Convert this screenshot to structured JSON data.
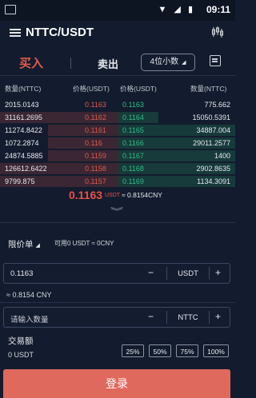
{
  "status_bar": {
    "time": "09:11",
    "icons": "▼ ◢ ▮"
  },
  "header": {
    "title": "NTTC/USDT"
  },
  "tabs": {
    "buy": "买入",
    "sell": "卖出",
    "decimals": "4位小数"
  },
  "orderbook": {
    "headers": [
      "数量(NTTC)",
      "价格(USDT)",
      "价格(USDT)",
      "数量(NTTC)"
    ],
    "rows": [
      {
        "sell_qty": "2015.0143",
        "sell_price": "0.1163",
        "buy_price": "0.1163",
        "buy_qty": "775.662"
      },
      {
        "sell_qty": "31161.2695",
        "sell_price": "0.1162",
        "buy_price": "0.1164",
        "buy_qty": "15050.5391"
      },
      {
        "sell_qty": "11274.8422",
        "sell_price": "0.1161",
        "buy_price": "0.1165",
        "buy_qty": "34887.004"
      },
      {
        "sell_qty": "1072.2874",
        "sell_price": "0.116",
        "buy_price": "0.1166",
        "buy_qty": "29011.2577"
      },
      {
        "sell_qty": "24874.5885",
        "sell_price": "0.1159",
        "buy_price": "0.1167",
        "buy_qty": "1400"
      },
      {
        "sell_qty": "126612.6422",
        "sell_price": "0.1158",
        "buy_price": "0.1168",
        "buy_qty": "2902.8635"
      },
      {
        "sell_qty": "9799.875",
        "sell_price": "0.1157",
        "buy_price": "0.1169",
        "buy_qty": "1134.3091"
      }
    ],
    "last_price": "0.1163",
    "last_unit": "USDT",
    "last_cny": "≈ 0.8154CNY"
  },
  "order": {
    "type": "限价单",
    "available": "可用0 USDT ≈ 0CNY",
    "price_value": "0.1163",
    "price_unit": "USDT",
    "price_approx": "≈ 0.8154 CNY",
    "qty_placeholder": "请输入数量",
    "qty_unit": "NTTC",
    "minus": "−",
    "plus": "+",
    "amount_label": "交易额",
    "amount_value": "0 USDT",
    "percents": [
      "25%",
      "50%",
      "75%",
      "100%"
    ],
    "login": "登录"
  },
  "colors": {
    "buy_red": "#e0584a",
    "sell_green": "#2fbf86",
    "bg": "#131c2e",
    "login_btn": "#e0695e"
  },
  "icons": [
    "menu-icon",
    "kline-chart-icon",
    "order-list-icon",
    "chevron-down-icon"
  ]
}
